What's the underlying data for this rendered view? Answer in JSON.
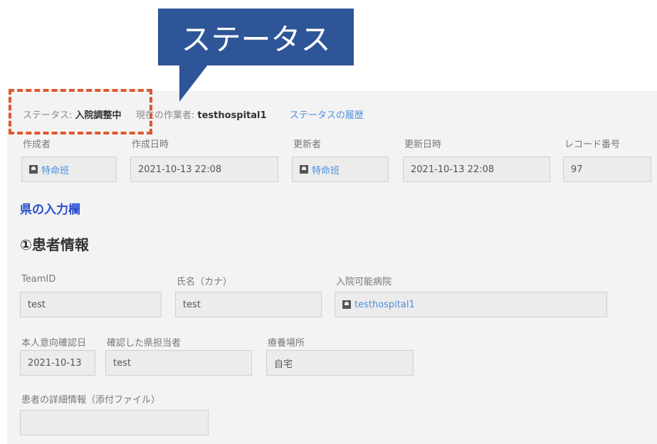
{
  "callout": {
    "text": "ステータス"
  },
  "status": {
    "label": "ステータス:",
    "value": "入院調整中",
    "worker_label": "現在の作業者:",
    "worker_value": "testhospital1",
    "history_link": "ステータスの履歴"
  },
  "meta": {
    "creator_label": "作成者",
    "creator_value": "特命班",
    "created_label": "作成日時",
    "created_value": "2021-10-13 22:08",
    "updater_label": "更新者",
    "updater_value": "特命班",
    "updated_label": "更新日時",
    "updated_value": "2021-10-13 22:08",
    "record_label": "レコード番号",
    "record_value": "97"
  },
  "section_link": "県の入力欄",
  "section_title": "①患者情報",
  "fields": {
    "teamid_label": "TeamID",
    "teamid_value": "test",
    "name_label": "氏名（カナ）",
    "name_value": "test",
    "hospital_label": "入院可能病院",
    "hospital_value": "testhospital1",
    "confirm_date_label": "本人意向確認日",
    "confirm_date_value": "2021-10-13",
    "confirmer_label": "確認した県担当者",
    "confirmer_value": "test",
    "location_label": "療養場所",
    "location_value": "自宅",
    "detail_label": "患者の詳細情報（添付ファイル）",
    "detail_value": ""
  },
  "icons": [
    "user-icon"
  ],
  "colors": {
    "callout": "#2e5597",
    "highlight": "#e0572a",
    "link": "#4a8fe0",
    "section_link": "#2d4fd0"
  }
}
